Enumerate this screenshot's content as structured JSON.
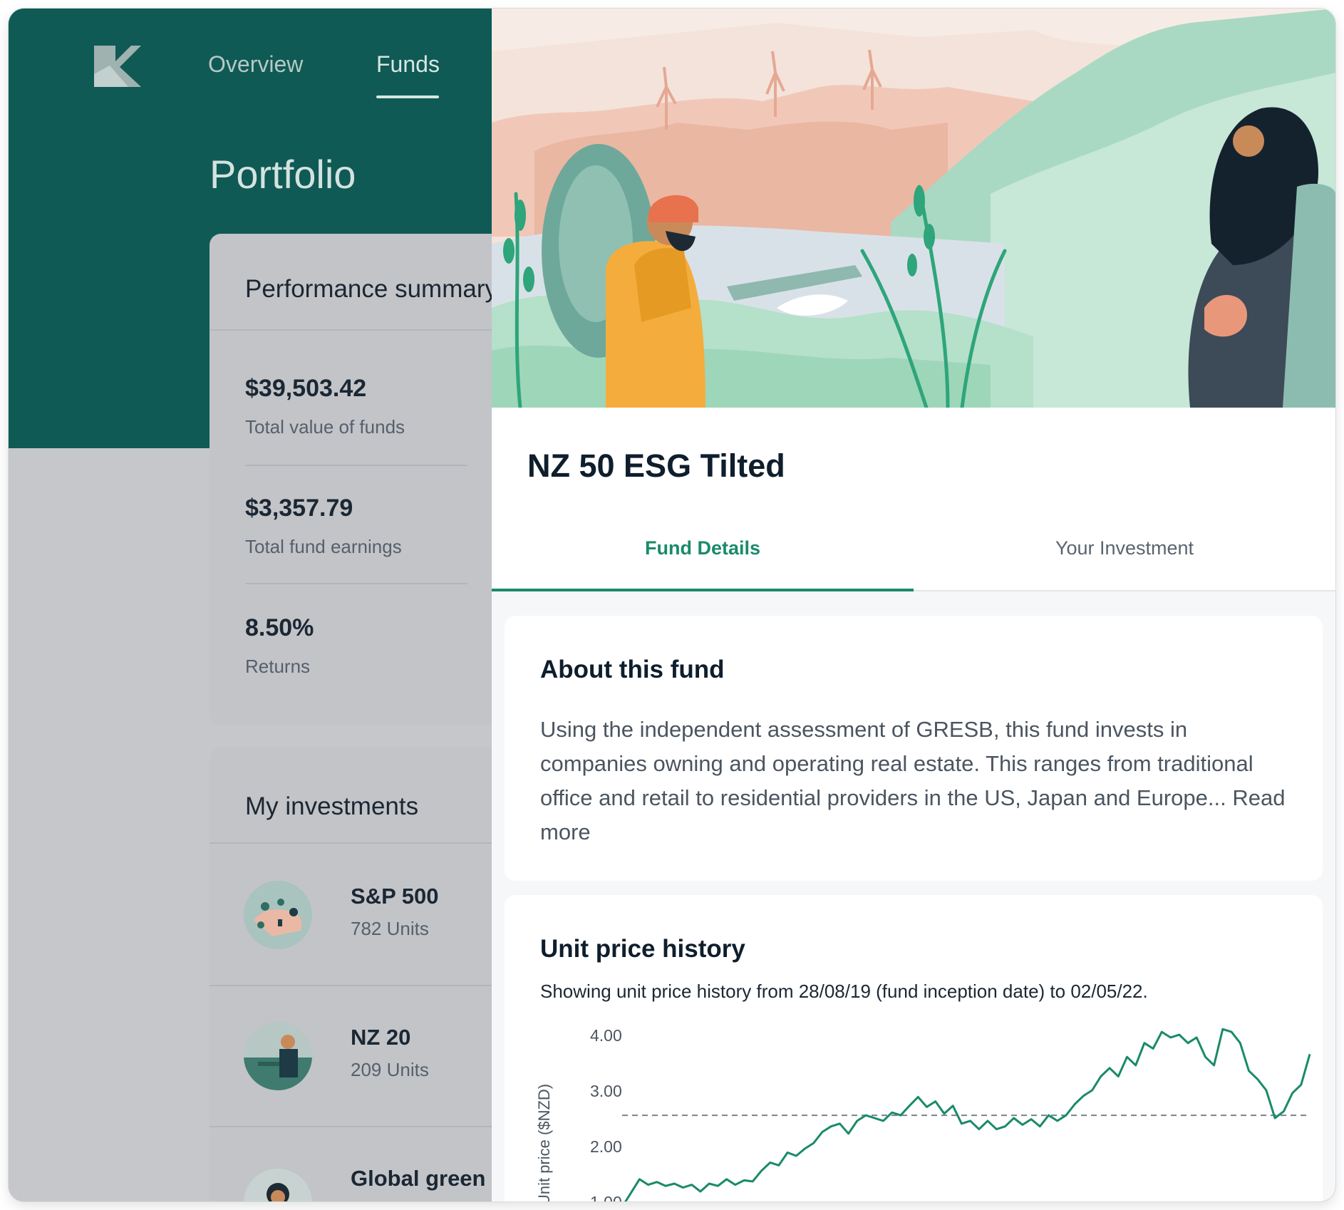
{
  "nav": {
    "overview": "Overview",
    "funds": "Funds"
  },
  "page_title": "Portfolio",
  "performance": {
    "title": "Performance summary",
    "stats": [
      {
        "value": "$39,503.42",
        "label": "Total value of funds"
      },
      {
        "value": "$3,357.79",
        "label": "Total fund earnings"
      },
      {
        "value": "8.50%",
        "label": "Returns"
      }
    ]
  },
  "investments": {
    "title": "My investments",
    "items": [
      {
        "name": "S&P 500",
        "units": "782 Units"
      },
      {
        "name": "NZ 20",
        "units": "209 Units"
      },
      {
        "name": "Global green",
        "units": ""
      }
    ]
  },
  "fund": {
    "title": "NZ 50 ESG Tilted",
    "tabs": [
      "Fund Details",
      "Your Investment"
    ],
    "active_tab": "Fund Details",
    "about_title": "About this fund",
    "about_text": "Using the independent assessment of GRESB, this fund invests in companies owning and operating real estate. This ranges from traditional office and retail to residential providers in the US, Japan and Europe... Read more",
    "history_title": "Unit price history",
    "history_subtitle": "Showing unit price history from 28/08/19 (fund inception date) to 02/05/22."
  },
  "colors": {
    "brand_green": "#0f5a54",
    "accent_green": "#1a8a6a",
    "overlay_grey": "#c5c7cb"
  },
  "chart_data": {
    "type": "line",
    "ylabel": "Unit price ($NZD)",
    "yticks": [
      "4.00",
      "3.00",
      "2.00",
      "1.00"
    ],
    "ylim": [
      1.0,
      4.0
    ],
    "reference_line": 2.55,
    "series": [
      {
        "values": [
          0.9,
          1.15,
          1.4,
          1.3,
          1.35,
          1.28,
          1.32,
          1.25,
          1.3,
          1.18,
          1.32,
          1.28,
          1.4,
          1.3,
          1.38,
          1.36,
          1.55,
          1.7,
          1.65,
          1.88,
          1.82,
          1.95,
          2.05,
          2.25,
          2.35,
          2.4,
          2.22,
          2.45,
          2.55,
          2.5,
          2.45,
          2.6,
          2.55,
          2.72,
          2.88,
          2.7,
          2.8,
          2.58,
          2.72,
          2.4,
          2.45,
          2.3,
          2.45,
          2.3,
          2.35,
          2.5,
          2.38,
          2.48,
          2.35,
          2.55,
          2.45,
          2.55,
          2.75,
          2.9,
          3.0,
          3.25,
          3.4,
          3.25,
          3.6,
          3.45,
          3.85,
          3.75,
          4.05,
          3.95,
          4.0,
          3.85,
          3.95,
          3.6,
          3.45,
          4.1,
          4.05,
          3.85,
          3.35,
          3.2,
          3.0,
          2.5,
          2.62,
          2.95,
          3.1,
          3.65
        ]
      }
    ]
  }
}
